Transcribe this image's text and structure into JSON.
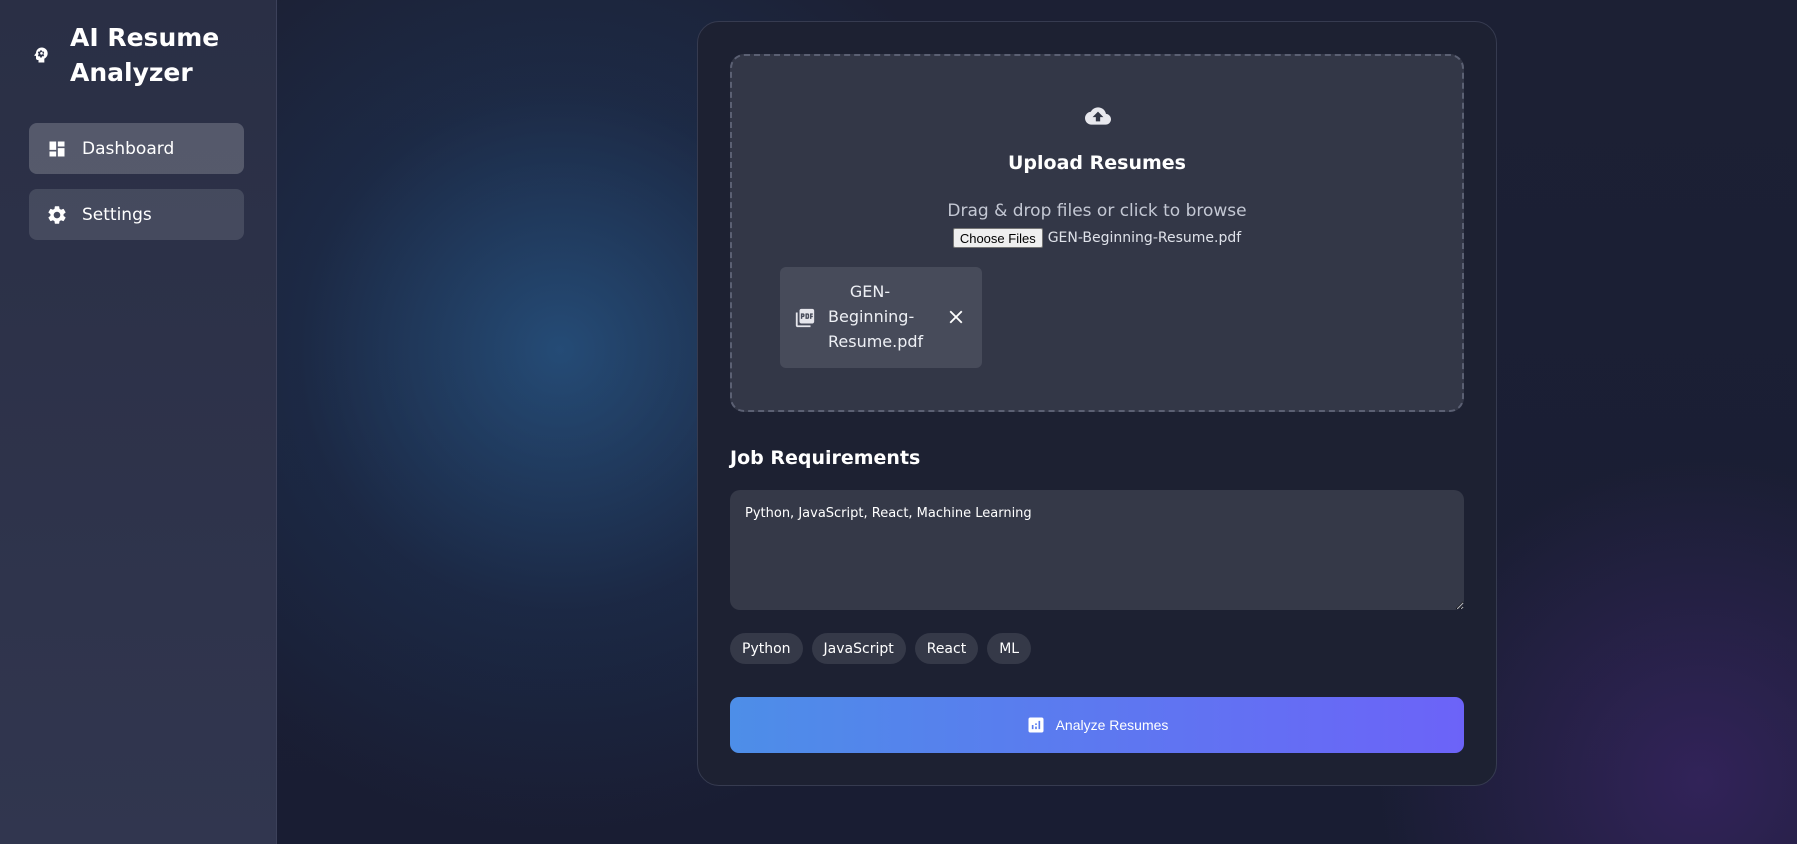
{
  "app": {
    "title": "AI Resume Analyzer"
  },
  "sidebar": {
    "items": [
      {
        "label": "Dashboard",
        "icon": "dashboard-icon"
      },
      {
        "label": "Settings",
        "icon": "gear-icon"
      }
    ]
  },
  "upload": {
    "icon": "cloud-upload-icon",
    "title": "Upload Resumes",
    "hint": "Drag & drop files or click to browse",
    "choose_label": "Choose Files",
    "chosen_file": "GEN-Beginning-Resume.pdf",
    "files": [
      {
        "name": "GEN-Beginning-Resume.pdf",
        "icon": "pdf-icon"
      }
    ]
  },
  "job": {
    "title": "Job Requirements",
    "requirements": "Python, JavaScript, React, Machine Learning",
    "tags": [
      "Python",
      "JavaScript",
      "React",
      "ML"
    ]
  },
  "analyze": {
    "label": "Analyze Resumes",
    "icon": "analytics-icon"
  },
  "colors": {
    "accent_start": "#4d8ee8",
    "accent_end": "#6c63f8",
    "panel": "#1d2132",
    "sidebar": "#2a2f45"
  }
}
